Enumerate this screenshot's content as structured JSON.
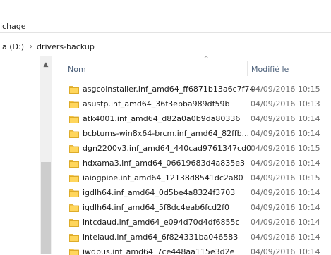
{
  "ribbon": {
    "tab_view": "ichage"
  },
  "address": {
    "drive": "a (D:)",
    "chevron": "›",
    "folder": "drivers-backup"
  },
  "icons": {
    "folder": "folder-icon",
    "sort": "sort-up-icon",
    "scroll_up": "scroll-up-arrow-icon"
  },
  "colors": {
    "folder_yellow": "#f5c342",
    "header_text": "#4c607a",
    "date_text": "#6d6d6d"
  },
  "columns": {
    "name": "Nom",
    "modified": "Modifié le"
  },
  "rows": [
    {
      "name": "asgcoinstaller.inf_amd64_ff6871b13a6c7f74",
      "date": "04/09/2016 10:15"
    },
    {
      "name": "asustp.inf_amd64_36f3ebba989df59b",
      "date": "04/09/2016 10:13"
    },
    {
      "name": "atk4001.inf_amd64_d82a0a0b9da80336",
      "date": "04/09/2016 10:14"
    },
    {
      "name": "bcbtums-win8x64-brcm.inf_amd64_82ffb...",
      "date": "04/09/2016 10:14"
    },
    {
      "name": "dgn2200v3.inf_amd64_440cad9761347cd0",
      "date": "04/09/2016 10:15"
    },
    {
      "name": "hdxama3.inf_amd64_06619683d4a835e3",
      "date": "04/09/2016 10:14"
    },
    {
      "name": "iaiogpioe.inf_amd64_12138d8541dc2a80",
      "date": "04/09/2016 10:15"
    },
    {
      "name": "igdlh64.inf_amd64_0d5be4a8324f3703",
      "date": "04/09/2016 10:14"
    },
    {
      "name": "igdlh64.inf_amd64_5f8dc4eab6fcd2f0",
      "date": "04/09/2016 10:14"
    },
    {
      "name": "intcdaud.inf_amd64_e094d70d4df6855c",
      "date": "04/09/2016 10:14"
    },
    {
      "name": "intelaud.inf_amd64_6f824331ba046583",
      "date": "04/09/2016 10:14"
    },
    {
      "name": "iwdbus.inf_amd64_7ce448aa115e3d2e",
      "date": "04/09/2016 10:14"
    }
  ]
}
